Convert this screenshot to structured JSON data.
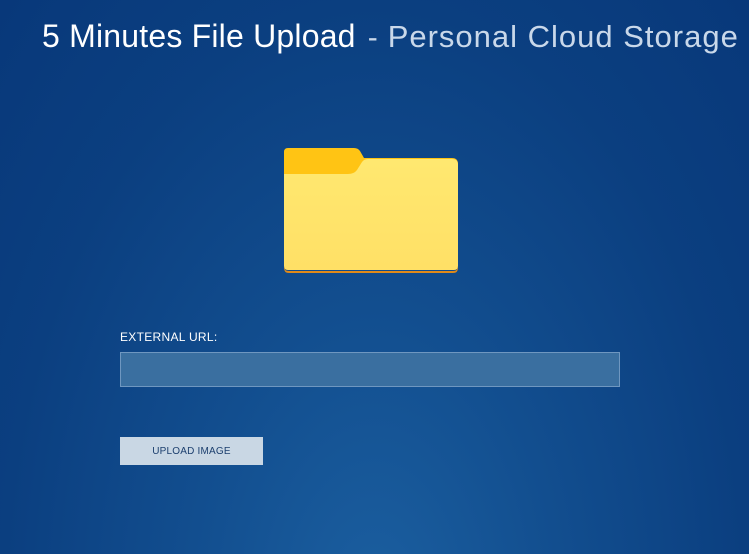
{
  "header": {
    "title": "5 Minutes File Upload",
    "separator": "-",
    "subtitle": "Personal Cloud Storage"
  },
  "hero": {
    "icon": "folder-icon"
  },
  "form": {
    "url_label": "EXTERNAL URL:",
    "url_value": "",
    "upload_button": "UPLOAD IMAGE"
  },
  "colors": {
    "background": "#0b3f80",
    "input_bg": "#3a6fa0",
    "button_bg": "#c9d7e4",
    "folder_front": "#ffe26b",
    "folder_tab": "#ffc414",
    "folder_bottom": "#e08a1a"
  }
}
